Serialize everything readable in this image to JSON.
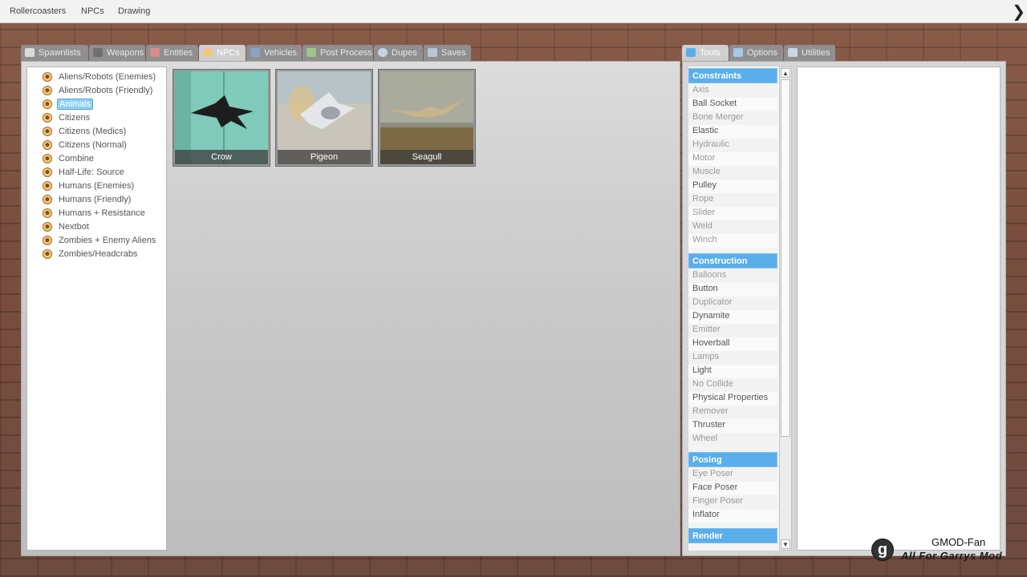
{
  "menubar": {
    "items": [
      "Rollercoasters",
      "NPCs",
      "Drawing"
    ]
  },
  "spawn_tabs": [
    {
      "label": "Spawnlists",
      "icon": "grid-icon"
    },
    {
      "label": "Weapons",
      "icon": "gun-icon"
    },
    {
      "label": "Entities",
      "icon": "entities-icon"
    },
    {
      "label": "NPCs",
      "icon": "monkey-icon",
      "active": true
    },
    {
      "label": "Vehicles",
      "icon": "car-icon"
    },
    {
      "label": "Post Process",
      "icon": "picture-icon"
    },
    {
      "label": "Dupes",
      "icon": "dupe-icon"
    },
    {
      "label": "Saves",
      "icon": "save-icon"
    }
  ],
  "tool_tabs": [
    {
      "label": "Tools",
      "icon": "wrench-icon",
      "active": true
    },
    {
      "label": "Options",
      "icon": "wrench-icon"
    },
    {
      "label": "Utilities",
      "icon": "notepad-icon"
    }
  ],
  "npc_categories": [
    "Aliens/Robots (Enemies)",
    "Aliens/Robots (Friendly)",
    "Animals",
    "Citizens",
    "Citizens (Medics)",
    "Citizens (Normal)",
    "Combine",
    "Half-Life: Source",
    "Humans (Enemies)",
    "Humans (Friendly)",
    "Humans + Resistance",
    "Nextbot",
    "Zombies + Enemy Aliens",
    "Zombies/Headcrabs"
  ],
  "selected_category": "Animals",
  "npcs": [
    "Crow",
    "Pigeon",
    "Seagull"
  ],
  "tool_categories": [
    {
      "name": "Constraints",
      "tools": [
        "Axis",
        "Ball Socket",
        "Bone Merger",
        "Elastic",
        "Hydraulic",
        "Motor",
        "Muscle",
        "Pulley",
        "Rope",
        "Slider",
        "Weld",
        "Winch"
      ]
    },
    {
      "name": "Construction",
      "tools": [
        "Balloons",
        "Button",
        "Duplicator",
        "Dynamite",
        "Emitter",
        "Hoverball",
        "Lamps",
        "Light",
        "No Collide",
        "Physical Properties",
        "Remover",
        "Thruster",
        "Wheel"
      ]
    },
    {
      "name": "Posing",
      "tools": [
        "Eye Poser",
        "Face Poser",
        "Finger Poser",
        "Inflator"
      ]
    },
    {
      "name": "Render",
      "tools": []
    }
  ],
  "watermark": {
    "logo": "g",
    "line1": "GMOD-Fan",
    "line2": "All For Garrys Mod"
  },
  "colors": {
    "accent": "#5aaeea",
    "selection": "#8ed1f3"
  }
}
